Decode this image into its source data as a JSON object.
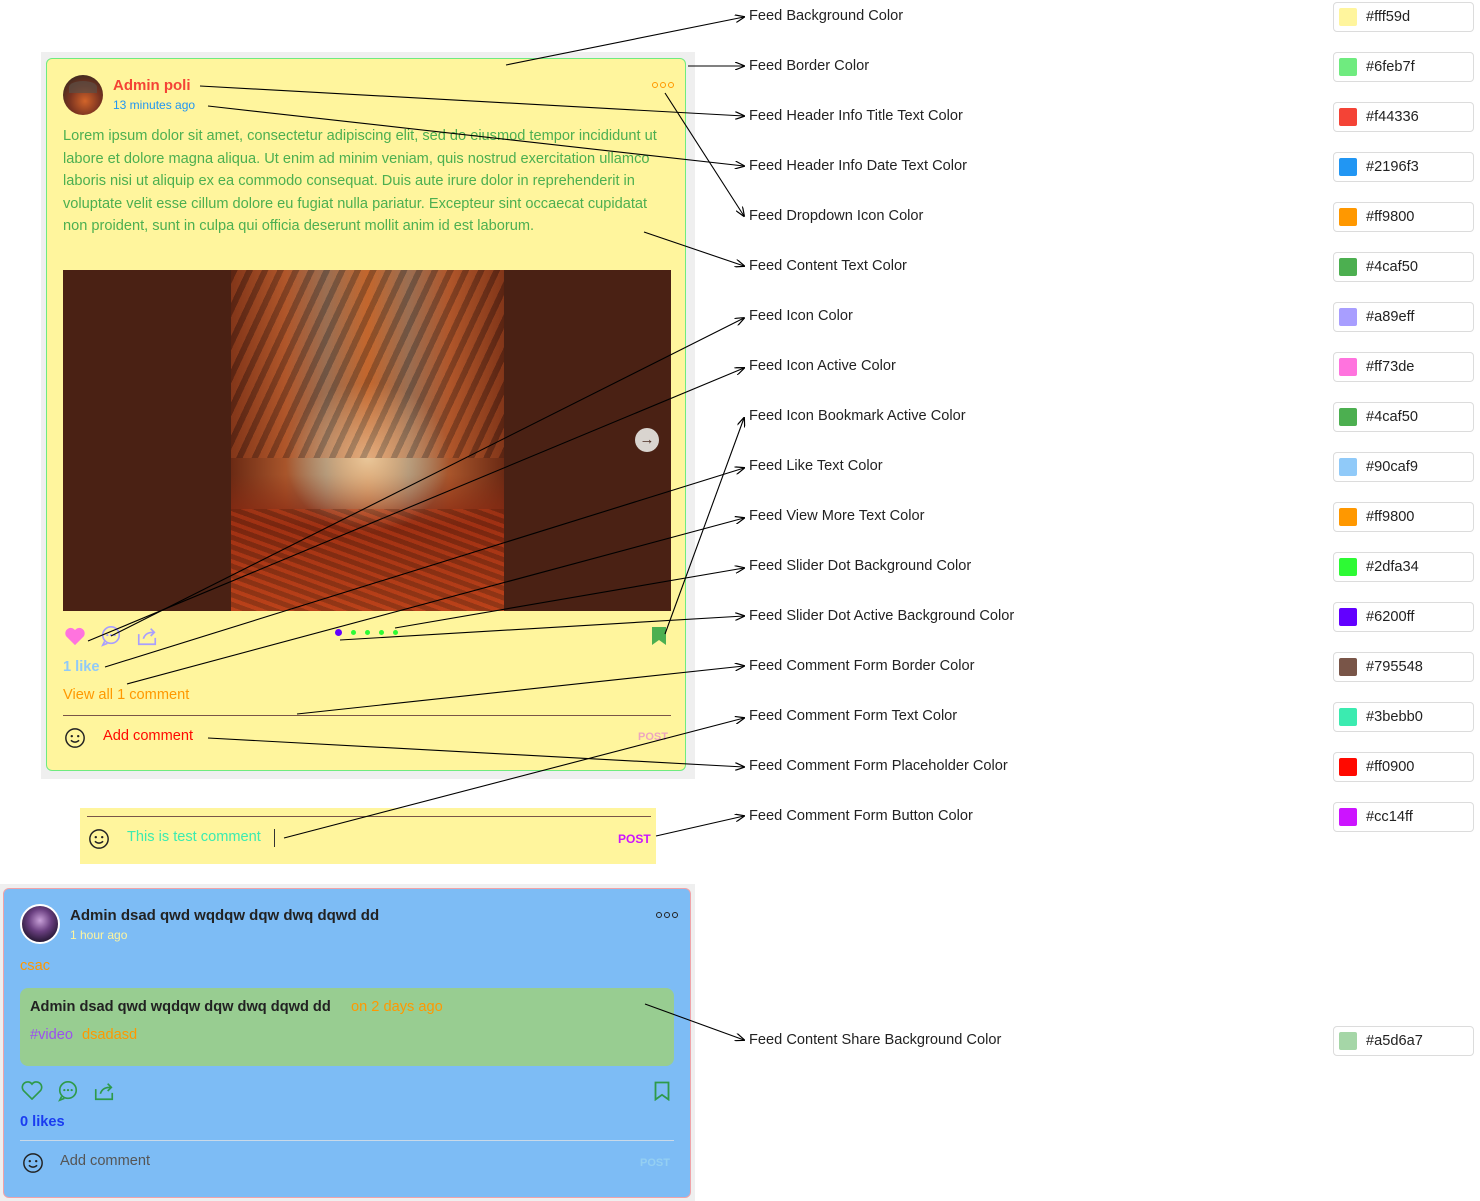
{
  "feed1": {
    "author": "Admin poli",
    "date": "13 minutes ago",
    "content": "Lorem ipsum dolor sit amet, consectetur adipiscing elit, sed do eiusmod tempor incididunt ut labore et dolore magna aliqua. Ut enim ad minim veniam, quis nostrud exercitation ullamco laboris nisi ut aliquip ex ea commodo consequat. Duis aute irure dolor in reprehenderit in voluptate velit esse cillum dolore eu fugiat nulla pariatur. Excepteur sint occaecat cupidatat non proident, sunt in culpa qui officia deserunt mollit anim id est laborum.",
    "likes": "1 like",
    "view_more": "View all 1 comment",
    "comment_placeholder": "Add comment",
    "post_label": "POST",
    "slider": {
      "count": 5,
      "active_index": 0
    },
    "icons": [
      "heart-icon",
      "comment-icon",
      "share-icon",
      "bookmark-icon",
      "more-dots-icon",
      "arrow-right-icon",
      "smile-icon"
    ]
  },
  "comment_form_example": {
    "text": "This is test comment",
    "post_label": "POST"
  },
  "feed2": {
    "author": "Admin dsad qwd wqdqw dqw dwq dqwd dd",
    "date": "1 hour ago",
    "content": "csac",
    "share": {
      "author": "Admin dsad qwd wqdqw dqw dwq dqwd dd",
      "date": "on 2 days ago",
      "tag": "#video",
      "text": "dsadasd"
    },
    "likes": "0 likes",
    "comment_placeholder": "Add comment",
    "post_label": "POST"
  },
  "settings": [
    {
      "label": "Feed Background Color",
      "value": "#fff59d"
    },
    {
      "label": "Feed Border Color",
      "value": "#6feb7f"
    },
    {
      "label": "Feed Header Info Title Text Color",
      "value": "#f44336"
    },
    {
      "label": "Feed Header Info Date Text Color",
      "value": "#2196f3"
    },
    {
      "label": "Feed Dropdown Icon Color",
      "value": "#ff9800"
    },
    {
      "label": "Feed Content Text Color",
      "value": "#4caf50"
    },
    {
      "label": "Feed Icon Color",
      "value": "#a89eff"
    },
    {
      "label": "Feed Icon Active Color",
      "value": "#ff73de"
    },
    {
      "label": "Feed Icon Bookmark Active Color",
      "value": "#4caf50"
    },
    {
      "label": "Feed Like Text Color",
      "value": "#90caf9"
    },
    {
      "label": "Feed View More Text Color",
      "value": "#ff9800"
    },
    {
      "label": "Feed Slider Dot Background Color",
      "value": "#2dfa34"
    },
    {
      "label": "Feed Slider Dot Active Background Color",
      "value": "#6200ff"
    },
    {
      "label": "Feed Comment Form Border Color",
      "value": "#795548"
    },
    {
      "label": "Feed Comment Form Text Color",
      "value": "#3bebb0"
    },
    {
      "label": "Feed Comment Form Placeholder Color",
      "value": "#ff0900"
    },
    {
      "label": "Feed Comment Form Button Color",
      "value": "#cc14ff"
    },
    {
      "label": "Feed Content Share Background Color",
      "value": "#a5d6a7"
    }
  ]
}
